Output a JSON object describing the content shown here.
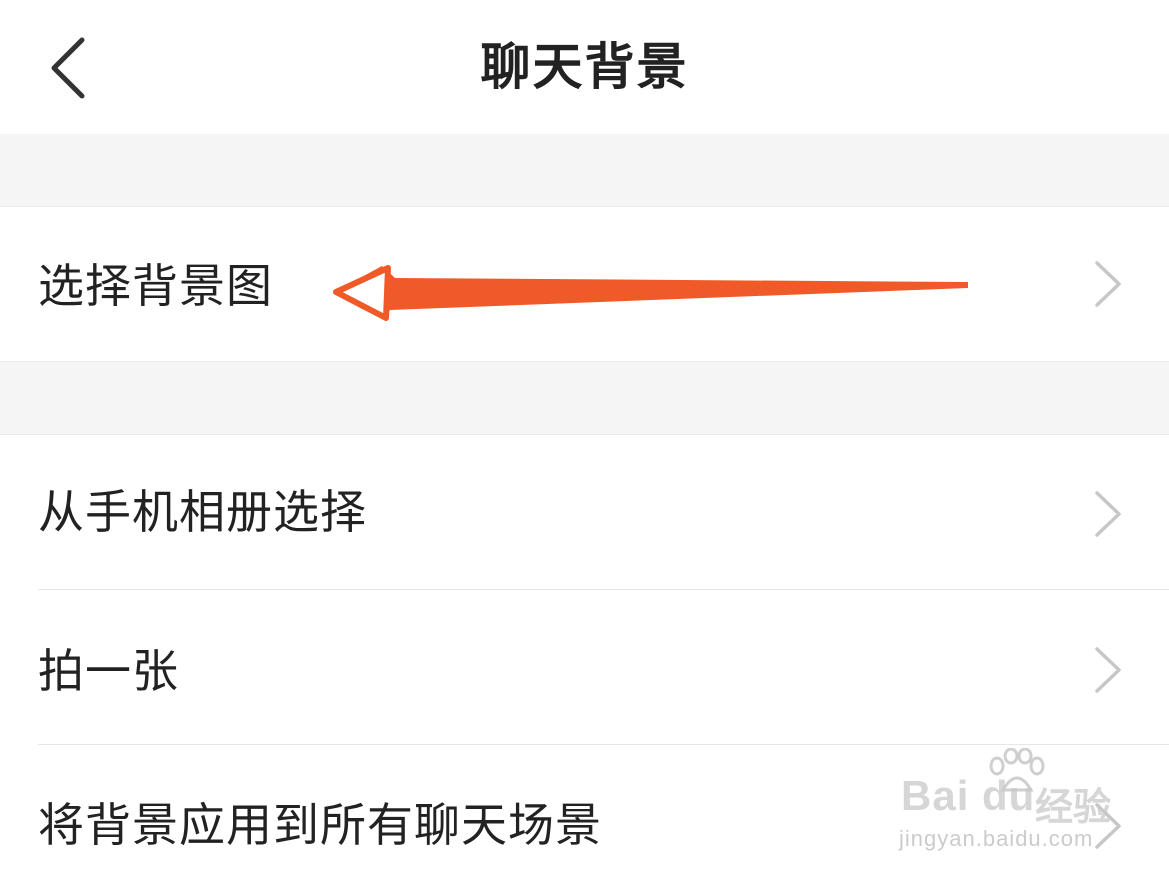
{
  "nav": {
    "title": "聊天背景",
    "back_icon": "chevron-left-icon"
  },
  "sections": {
    "select_bg": {
      "label": "选择背景图"
    },
    "options": [
      {
        "label": "从手机相册选择"
      },
      {
        "label": "拍一张"
      },
      {
        "label": "将背景应用到所有聊天场景"
      }
    ]
  },
  "annotation": {
    "arrow_color": "#f05a28",
    "arrow_icon": "arrow-left-annotation"
  },
  "watermark": {
    "logo_text": "Bai du",
    "cn_text": "经验",
    "url_text": "jingyan.baidu.com"
  },
  "colors": {
    "background": "#f5f5f5",
    "cell": "#ffffff",
    "text": "#222222",
    "chevron": "#c7c7c7"
  }
}
